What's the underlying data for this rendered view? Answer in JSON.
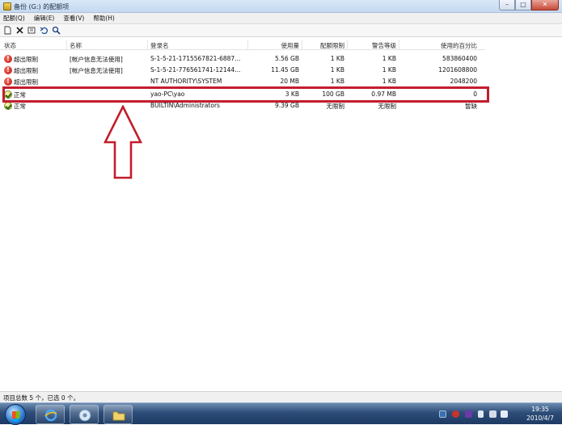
{
  "window": {
    "title": "备份 (G:) 的配额项",
    "buttons": [
      "–",
      "□",
      "✕"
    ]
  },
  "menu": [
    "配额(Q)",
    "编辑(E)",
    "查看(V)",
    "帮助(H)"
  ],
  "toolbar": {
    "icons": [
      "new-entry-icon",
      "delete-icon",
      "properties-icon",
      "undo-icon",
      "find-icon"
    ]
  },
  "table": {
    "columns": [
      "状态",
      "名称",
      "登录名",
      "使用量",
      "配额限制",
      "警告等级",
      "使用的百分比"
    ],
    "rows": [
      {
        "status": "超出限制",
        "status_type": "error",
        "name": "[帐户信息无法使用]",
        "login": "S-1-5-21-1715567821-6887...",
        "used": "5.56 GB",
        "limit": "1 KB",
        "warning": "1 KB",
        "percent": "583860400"
      },
      {
        "status": "超出限制",
        "status_type": "error",
        "name": "[帐户信息无法使用]",
        "login": "S-1-5-21-776561741-12144...",
        "used": "11.45 GB",
        "limit": "1 KB",
        "warning": "1 KB",
        "percent": "1201608800"
      },
      {
        "status": "超出限制",
        "status_type": "error",
        "name": "",
        "login": "NT AUTHORITY\\SYSTEM",
        "used": "20 MB",
        "limit": "1 KB",
        "warning": "1 KB",
        "percent": "2048200"
      },
      {
        "status": "正常",
        "status_type": "ok",
        "name": "",
        "login": "yao-PC\\yao",
        "used": "3 KB",
        "limit": "100 GB",
        "warning": "0.97 MB",
        "percent": "0"
      },
      {
        "status": "正常",
        "status_type": "ok",
        "name": "",
        "login": "BUILTIN\\Administrators",
        "used": "9.39 GB",
        "limit": "无限制",
        "warning": "无限制",
        "percent": "暂缺"
      }
    ]
  },
  "statusbar": {
    "text": "项目总数 5 个，已选 0 个。"
  },
  "clock": {
    "time": "19:35",
    "date": "2010/4/7"
  },
  "colors": {
    "highlight": "#c21d2b",
    "taskbar": "#2d4d78"
  }
}
